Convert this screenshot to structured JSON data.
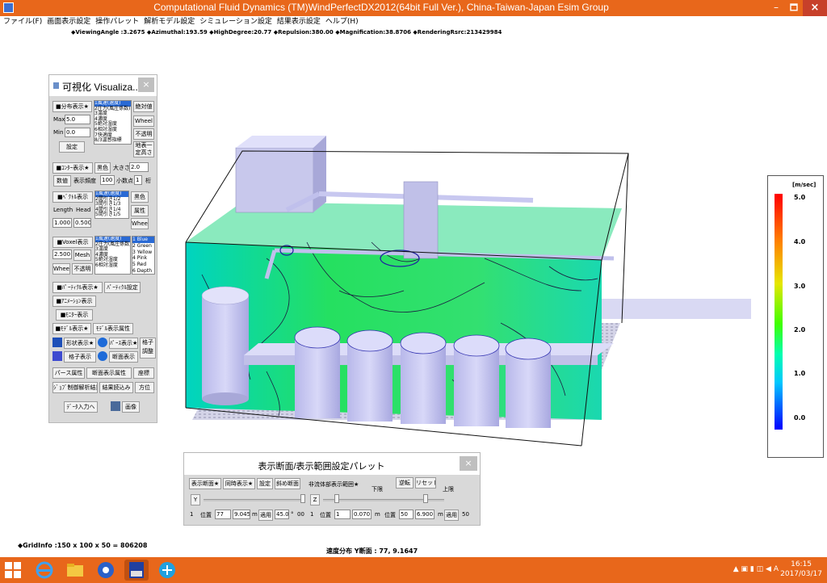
{
  "window": {
    "title": "Computational Fluid Dynamics (TM)WindPerfectDX2012(64bit Full Ver.), China-Taiwan-Japan Esim Group",
    "minimize": "–",
    "maximize": "🗖",
    "close": "×"
  },
  "menu": [
    "ファイル(F)",
    "画面表示設定",
    "操作パレット",
    "解析モデル設定",
    "シミュレーション設定",
    "結果表示設定",
    "ヘルプ(H)"
  ],
  "viewinfo": "◆ViewingAngle :3.2675  ◆Azimuthal:193.59  ◆HighDegree:20.77  ◆Repulsion:380.00   ◆Magnification:38.8706  ◆RenderingRsrc:213429984",
  "viz": {
    "title": "可視化 Visualiza...",
    "close": "×",
    "dist_label": "■分布表示★",
    "abs_btn": "絶対値",
    "max_label": "Max",
    "max_value": "5.0",
    "min_label": "Min",
    "min_value": "0.0",
    "wheel": "Wheel",
    "opaque": "不透明",
    "settings": "設定",
    "ground": "地表一定高さ",
    "dist_list": [
      "1風速(速度)",
      "2圧力(風圧係数)",
      "3温度",
      "4濃度",
      "5絶対湿度",
      "6相対湿度",
      "7快適度",
      "8/3温感指標"
    ],
    "contour_label": "■ｺﾝﾀｰ表示★",
    "black": "黒色",
    "size_label": "大きさ",
    "size_value": "2.0",
    "value_btn": "数値",
    "freq_label": "表示頻度",
    "freq_value": "100",
    "decimal_label": "小数点",
    "decimal_value": "1",
    "digit": "桁",
    "vector_label": "■ﾍﾞｸﾄﾙ表示",
    "vector_list": [
      "1風速(速度)",
      "2間引き1/2",
      "3間引き1/3",
      "4間引き1/4",
      "5間引き1/5"
    ],
    "black2": "黒色",
    "attr": "属性",
    "length_label": "Length",
    "head_label": "Head",
    "length_value": "1.000",
    "head_value": "0.500",
    "wheel2": "Wheel",
    "voxel_label": "■Voxel表示",
    "voxel_list": [
      "1風速(速度)",
      "2圧力(風圧係数)",
      "3温度",
      "4濃度",
      "5絶対湿度",
      "6相対湿度"
    ],
    "color_list": [
      "1 Blue",
      "2 Green",
      "3 Yellow",
      "4 Pink",
      "5 Red",
      "6 Depth"
    ],
    "voxel_value": "2.500",
    "mesh": "Mesh",
    "wheel3": "Wheel",
    "opaque2": "不透明",
    "particle": "■ﾊﾟｰﾃｨｸﾙ表示★",
    "particle_set": "ﾊﾟｰﾃｨｸﾙ設定",
    "anim": "■ｱﾆﾒｰｼｮﾝ表示",
    "monitor": "■ﾓﾆﾀｰ表示",
    "model_disp": "■ﾓﾃﾞﾙ表示★",
    "model_attr": "ﾓﾃﾞﾙ表示属性",
    "shape_disp": "形状表示★",
    "perse_disp": "ﾊﾟｰｽ表示★",
    "grid_adj": "格子調整",
    "grid_disp": "格子表示",
    "section_disp": "断面表示",
    "perse_attr": "パース属性",
    "section_attr": "断面表示属性",
    "coord": "座標",
    "job_results": "ｼﾞｮﾌﾞ制御解析結果",
    "read_results": "結果読込み",
    "direction": "方位",
    "data_input": "ﾃﾞｰﾀ入力へ",
    "image": "画像"
  },
  "scale": {
    "unit": "[m/sec]",
    "ticks": [
      "5.0",
      "4.0",
      "3.0",
      "2.0",
      "1.0",
      "0.0"
    ],
    "colors": [
      "#ff0000",
      "#ff8000",
      "#e6e600",
      "#40ff00",
      "#00ffb0",
      "#00c8ff",
      "#0050ff",
      "#0000ff"
    ]
  },
  "section": {
    "title": "表示断面/表示範囲設定パレット",
    "close": "×",
    "disp_section": "表示断面★",
    "sim_disp": "同時表示★",
    "setting": "設定",
    "clip_section": "斜め断面",
    "nonfluid": "非流体部表示範囲★",
    "lower": "下限",
    "reverse": "逆転",
    "reset": "リセット",
    "upper": "上限",
    "axis1": "Y",
    "axis2": "Z",
    "left_min": "1",
    "pos_label": "位置",
    "pos_value": "77",
    "m_value": "9.045",
    "m_unit": "m",
    "apply": "適用",
    "angle_value": "45.0",
    "deg_unit": "°",
    "range_right": "00",
    "z_min": "1",
    "z_pos_label": "位置",
    "z_pos": "1",
    "z_m": "0.070",
    "z_unit": "m",
    "z2_pos_label": "位置",
    "z2_pos": "50",
    "z2_m": "6.900",
    "z2_unit": "m",
    "apply2": "適用",
    "z_max": "50"
  },
  "status": {
    "grid": "◆GridInfo :150 x 100 x 50 = 806208",
    "section": "速度分布  Y断面 : 77,  9.1647"
  },
  "taskbar": {
    "tray": "▲ ▣ ▮ ◫ ◀  A",
    "time": "16:15",
    "date": "2017/03/17"
  },
  "theme": {
    "titlebar": "#e8671b",
    "close": "#c7402a",
    "panel": "#d9d9d9"
  }
}
